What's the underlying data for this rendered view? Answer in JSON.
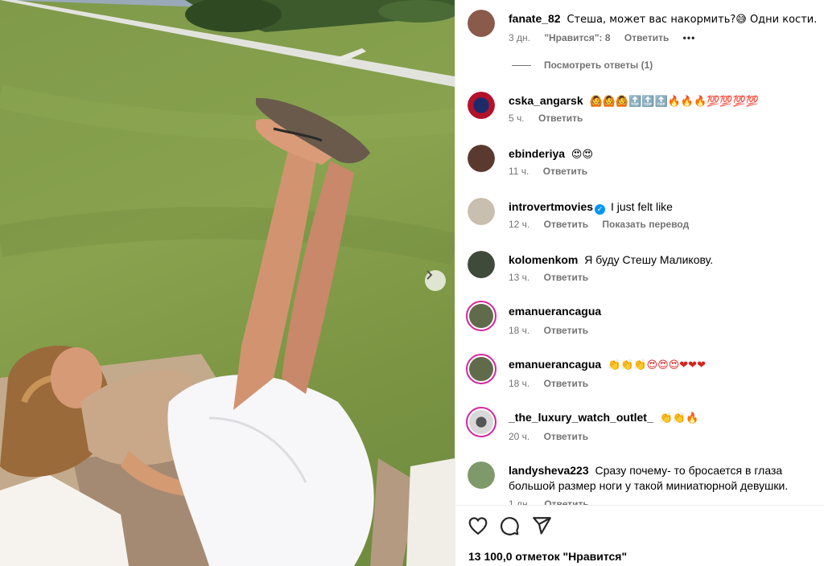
{
  "post": {
    "likes_text": "13 100,0 отметок \"Нравится\""
  },
  "comments": [
    {
      "username": "fanate_82",
      "text": "Стеша, может вас накормить?😅 Одни кости.",
      "time": "3 дн.",
      "likes": "\"Нравится\": 8",
      "reply": "Ответить",
      "avatar_color": "#8a5a4a",
      "more_icon": "more-dots-icon"
    },
    {
      "username": "cska_angarsk",
      "text": "🙆🙆🙆🔝🔝🔝🔥🔥🔥💯💯💯💯",
      "time": "5 ч.",
      "reply": "Ответить",
      "avatar_color": "#b3122a"
    },
    {
      "username": "ebinderiya",
      "text": "😍😍",
      "time": "11 ч.",
      "reply": "Ответить",
      "avatar_color": "#5a3a2e"
    },
    {
      "username": "introvertmovies",
      "text": "I just felt like",
      "time": "12 ч.",
      "reply": "Ответить",
      "translate": "Показать перевод",
      "avatar_color": "#c9bfae",
      "verified": true
    },
    {
      "username": "kolomenkom",
      "text": "Я буду Стешу Маликову.",
      "time": "13 ч.",
      "reply": "Ответить",
      "avatar_color": "#3f4a3a"
    },
    {
      "username": "emanuerancagua",
      "text": "",
      "time": "18 ч.",
      "reply": "Ответить",
      "avatar_color": "#5f6b4a"
    },
    {
      "username": "emanuerancagua",
      "text": "👏👏👏😍😍😍❤❤❤",
      "time": "18 ч.",
      "reply": "Ответить",
      "avatar_color": "#5f6b4a"
    },
    {
      "username": "_the_luxury_watch_outlet_",
      "text": "👏👏🔥",
      "time": "20 ч.",
      "reply": "Ответить",
      "avatar_color": "#d8d8d8"
    },
    {
      "username": "landysheva223",
      "text": "Сразу почему- то бросается в глаза большой размер ноги у такой миниатюрной девушки.",
      "time": "1 дн.",
      "reply": "Ответить",
      "avatar_color": "#7f9a6a"
    }
  ],
  "view_replies": "Посмотреть ответы (1)",
  "icons": [
    "heart-icon",
    "comment-icon",
    "share-icon",
    "chevron-right-icon"
  ]
}
